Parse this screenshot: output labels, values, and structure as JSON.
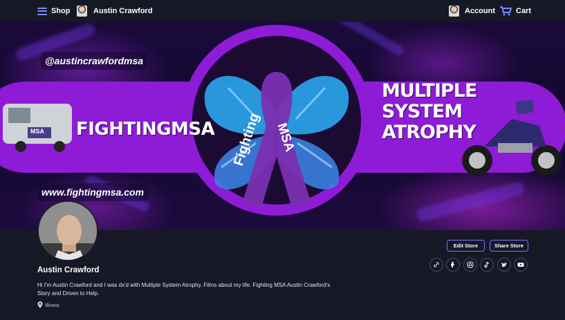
{
  "nav": {
    "shop_label": "Shop",
    "store_name": "Austin Crawford",
    "account_label": "Account",
    "cart_label": "Cart"
  },
  "banner": {
    "handle": "@austincrawfordmsa",
    "website": "www.fightingmsa.com",
    "left_title": "FIGHTINGMSA",
    "right_lines": [
      "MULTIPLE",
      "SYSTEM",
      "ATROPHY"
    ],
    "ribbon_word_1": "Fighting",
    "ribbon_word_2": "MSA",
    "van_text": "MSA"
  },
  "actions": {
    "edit_store": "Edit Store",
    "share_store": "Share Store"
  },
  "socials": [
    "link-icon",
    "facebook-icon",
    "instagram-icon",
    "tiktok-icon",
    "twitter-icon",
    "youtube-icon"
  ],
  "profile": {
    "name": "Austin Crawford",
    "bio": "Hi I'm Austin Crawford and I was dx'd with Multiple System Atrophy. Films about my life. Fighting MSA Austin Crawford's Story and Driven to Help.",
    "location": "Illinois"
  },
  "colors": {
    "background": "#161826",
    "accent": "#6f7dff",
    "banner_purple": "#8e1bd6"
  }
}
